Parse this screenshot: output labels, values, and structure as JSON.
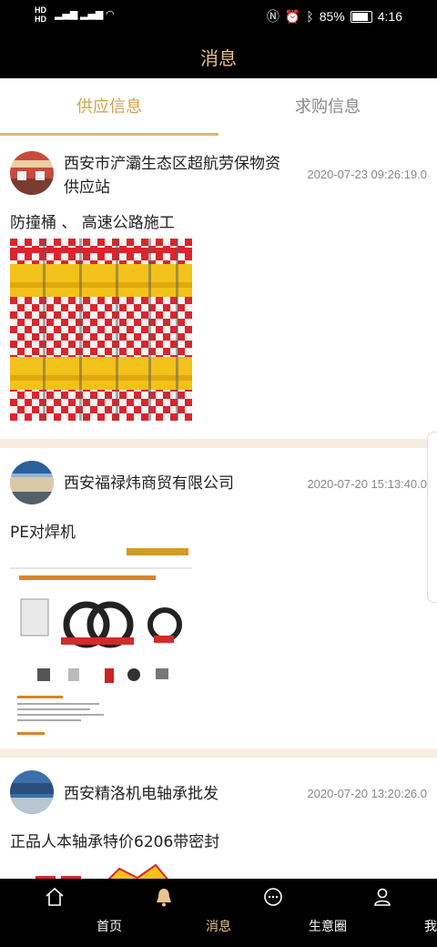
{
  "status_bar": {
    "hd1": "HD",
    "hd2": "HD",
    "network": "4G",
    "battery": "85%",
    "time": "4:16"
  },
  "header": {
    "title": "消息"
  },
  "tabs": [
    {
      "label": "供应信息"
    },
    {
      "label": "求购信息"
    }
  ],
  "posts": [
    {
      "company": "西安市浐灞生态区超航劳保物资供应站",
      "time": "2020-07-23 09:26:19.0",
      "title": "防撞桶 、 高速公路施工"
    },
    {
      "company": "西安福禄炜商贸有限公司",
      "time": "2020-07-20 15:13:40.0",
      "title": "PE对焊机"
    },
    {
      "company": "西安精洛机电轴承批发",
      "time": "2020-07-20 13:20:26.0",
      "title": "正品人本轴承特价6206带密封"
    }
  ],
  "bottom_nav": [
    {
      "label": "首页",
      "icon": "home-icon"
    },
    {
      "label": "消息",
      "icon": "bell-icon"
    },
    {
      "label": "生意圈",
      "icon": "chat-icon"
    },
    {
      "label": "我的",
      "icon": "user-icon"
    }
  ],
  "colors": {
    "accent": "#e8c48e",
    "tab_active": "#d6a24c",
    "bar_bg": "#000000"
  }
}
